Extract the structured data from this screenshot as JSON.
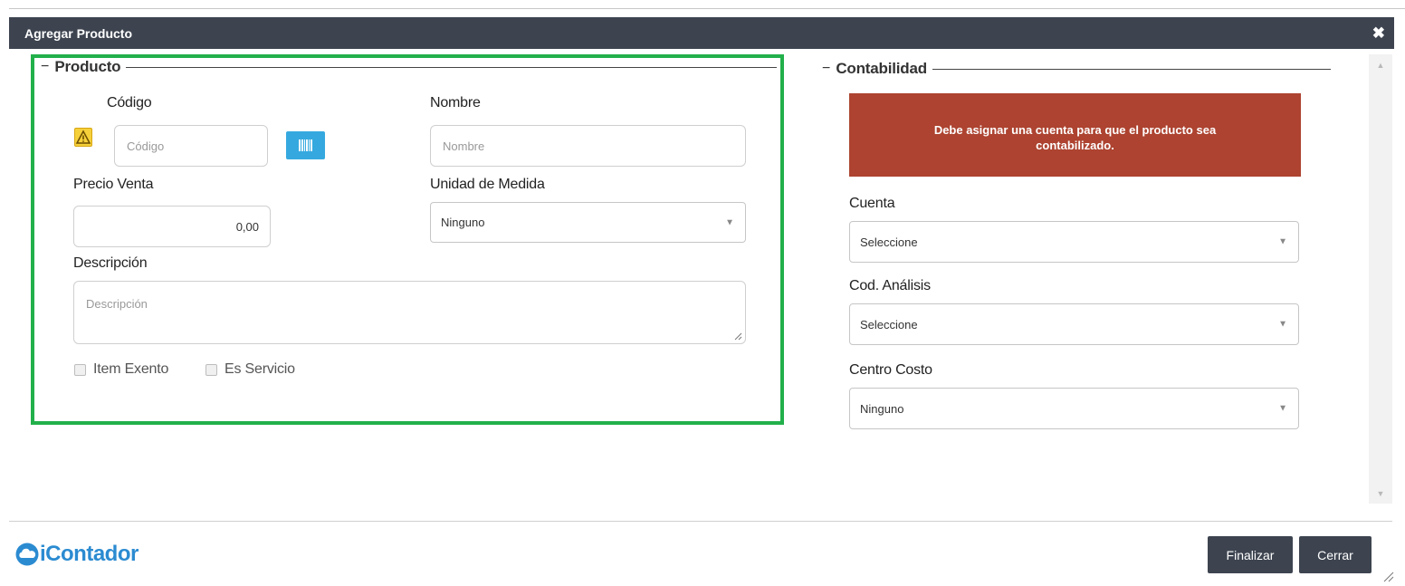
{
  "dialog": {
    "title": "Agregar Producto",
    "close_symbol": "✖"
  },
  "producto": {
    "legend": "Producto",
    "codigo": {
      "label": "Código",
      "placeholder": "Código"
    },
    "nombre": {
      "label": "Nombre",
      "placeholder": "Nombre"
    },
    "precio_venta": {
      "label": "Precio Venta",
      "value": "0,00"
    },
    "unidad_medida": {
      "label": "Unidad de Medida",
      "selected": "Ninguno"
    },
    "descripcion": {
      "label": "Descripción",
      "placeholder": "Descripción"
    },
    "checkboxes": [
      {
        "label": "Item Exento",
        "checked": false
      },
      {
        "label": "Es Servicio",
        "checked": false
      }
    ]
  },
  "contabilidad": {
    "legend": "Contabilidad",
    "alert": "Debe asignar una cuenta para que el producto sea contabilizado.",
    "cuenta": {
      "label": "Cuenta",
      "selected": "Seleccione"
    },
    "cod_analisis": {
      "label": "Cod. Análisis",
      "selected": "Seleccione"
    },
    "centro_costo": {
      "label": "Centro Costo",
      "selected": "Ninguno"
    }
  },
  "footer": {
    "logo_text": "iContador",
    "buttons": {
      "finalizar": "Finalizar",
      "cerrar": "Cerrar"
    }
  },
  "icons": {
    "legend_toggle": "−",
    "caret": "▼",
    "scroll_up": "▲",
    "scroll_down": "▼",
    "warning": "warning-icon",
    "barcode": "barcode-icon",
    "cloud": "cloud-icon"
  },
  "colors": {
    "titlebar": "#3d4450",
    "highlight": "#22b04b",
    "alert": "#ad4330",
    "barcode_button": "#35a9df",
    "brand": "#2b8bd1"
  }
}
